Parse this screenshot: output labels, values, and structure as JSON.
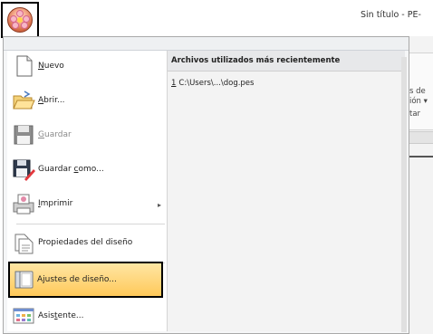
{
  "window": {
    "title": "Sin título - PE-"
  },
  "app_button": {
    "icon": "flower-orb-icon"
  },
  "ribbon": {
    "fragments": [
      "s de",
      "ión ▾",
      "tar"
    ]
  },
  "menu": {
    "items": [
      {
        "pre": "",
        "ul": "N",
        "post": "uevo",
        "icon": "new-document-icon",
        "enabled": true
      },
      {
        "pre": "",
        "ul": "A",
        "post": "brir...",
        "icon": "open-folder-icon",
        "enabled": true
      },
      {
        "pre": "",
        "ul": "G",
        "post": "uardar",
        "icon": "save-disk-icon",
        "enabled": false
      },
      {
        "pre": "Guardar ",
        "ul": "c",
        "post": "omo...",
        "icon": "save-as-icon",
        "enabled": true
      },
      {
        "pre": "",
        "ul": "I",
        "post": "mprimir",
        "icon": "print-icon",
        "enabled": true,
        "submenu": "▸"
      },
      {
        "pre": "",
        "ul": "",
        "post": "Propiedades del diseño",
        "icon": "properties-icon",
        "enabled": true
      },
      {
        "pre": "",
        "ul": "",
        "post": "Ajustes de diseño...",
        "icon": "design-settings-icon",
        "enabled": true,
        "selected": true
      },
      {
        "pre": "Asis",
        "ul": "t",
        "post": "ente...",
        "icon": "wizard-icon",
        "enabled": true
      }
    ]
  },
  "recent": {
    "header": "Archivos utilizados más recientemente",
    "items": [
      {
        "num": "1",
        "path": "C:\\Users\\...\\dog.pes"
      }
    ]
  }
}
